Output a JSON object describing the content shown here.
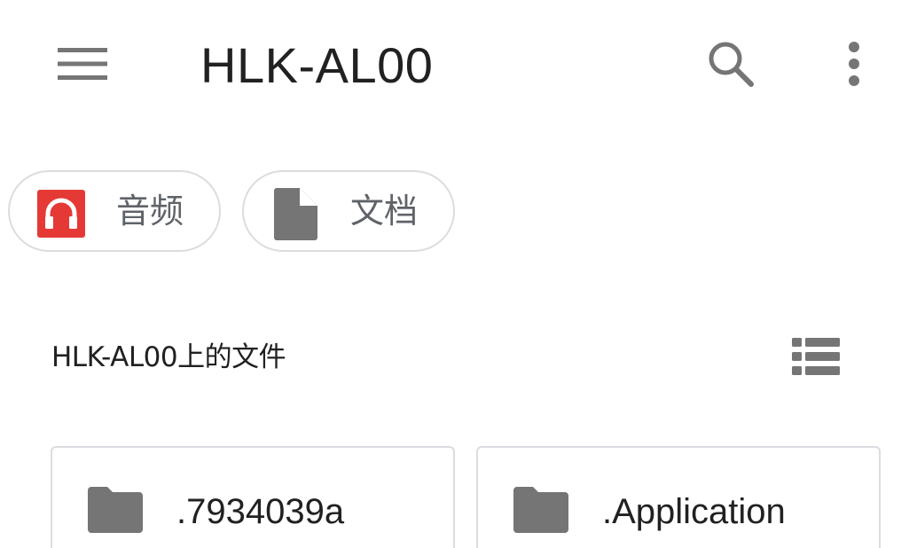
{
  "toolbar": {
    "title": "HLK-AL00",
    "icons": {
      "menu": "menu-icon",
      "search": "search-icon",
      "more": "more-vert-icon"
    }
  },
  "chips": [
    {
      "label": "音频",
      "icon": "headphones-icon",
      "icon_color": "#e53935"
    },
    {
      "label": "文档",
      "icon": "document-icon",
      "icon_color": "#757575"
    }
  ],
  "section": {
    "title": "HLK-AL00上的文件",
    "view_icon": "list-view-icon"
  },
  "folders": [
    {
      "name": ".7934039a",
      "icon": "folder-icon"
    },
    {
      "name": ".Application",
      "icon": "folder-icon"
    }
  ],
  "colors": {
    "icon_gray": "#757575",
    "text_primary": "#212121",
    "chip_border": "#dcdcdc",
    "audio_red": "#e53935"
  }
}
